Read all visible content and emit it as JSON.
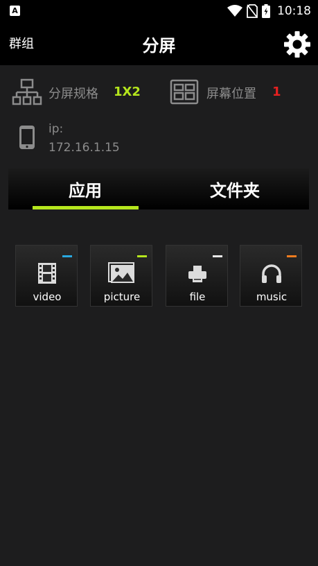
{
  "status_bar": {
    "app_icon_letter": "A",
    "time": "10:18"
  },
  "app_bar": {
    "group_label": "群组",
    "title": "分屏",
    "settings_icon": "gear-icon"
  },
  "info": {
    "split_label": "分屏规格",
    "split_value": "1X2",
    "position_label": "屏幕位置",
    "position_value": "1",
    "ip_label": "ip:",
    "ip_value": "172.16.1.15"
  },
  "tabs": [
    {
      "label": "应用",
      "active": true
    },
    {
      "label": "文件夹",
      "active": false
    }
  ],
  "colors": {
    "accent_green": "#b5e61d",
    "accent_red": "#e62020",
    "video": "#29a8e0",
    "picture": "#b5e61d",
    "file": "#e8e8e8",
    "music": "#f07c1f"
  },
  "apps": [
    {
      "label": "video",
      "icon": "film-icon"
    },
    {
      "label": "picture",
      "icon": "image-icon"
    },
    {
      "label": "file",
      "icon": "printer-icon"
    },
    {
      "label": "music",
      "icon": "headphones-icon"
    }
  ]
}
